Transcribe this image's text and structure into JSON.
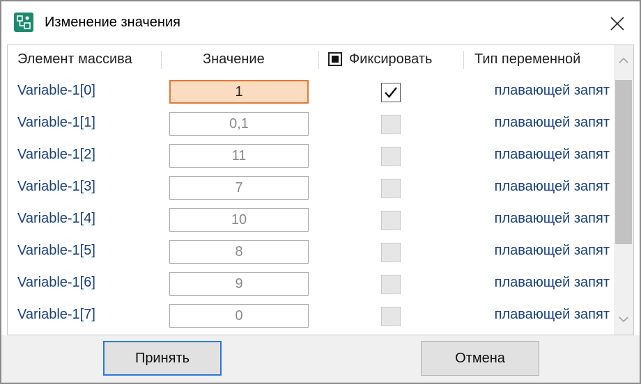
{
  "window": {
    "title": "Изменение значения",
    "icon": "app-icon",
    "close_icon": "close-icon"
  },
  "grid": {
    "headers": {
      "element": "Элемент массива",
      "value": "Значение",
      "fix": "Фиксировать",
      "type": "Тип переменной"
    },
    "rows": [
      {
        "name": "Variable-1[0]",
        "value": "1",
        "fixed": true,
        "type": "плавающей запят"
      },
      {
        "name": "Variable-1[1]",
        "value": "0,1",
        "fixed": false,
        "type": "плавающей запят"
      },
      {
        "name": "Variable-1[2]",
        "value": "11",
        "fixed": false,
        "type": "плавающей запят"
      },
      {
        "name": "Variable-1[3]",
        "value": "7",
        "fixed": false,
        "type": "плавающей запят"
      },
      {
        "name": "Variable-1[4]",
        "value": "10",
        "fixed": false,
        "type": "плавающей запят"
      },
      {
        "name": "Variable-1[5]",
        "value": "8",
        "fixed": false,
        "type": "плавающей запят"
      },
      {
        "name": "Variable-1[6]",
        "value": "9",
        "fixed": false,
        "type": "плавающей запят"
      },
      {
        "name": "Variable-1[7]",
        "value": "0",
        "fixed": false,
        "type": "плавающей запят"
      }
    ]
  },
  "footer": {
    "accept_label": "Принять",
    "cancel_label": "Отмена"
  },
  "colors": {
    "accent_border": "#2b78d4",
    "active_cell_bg": "#fcdcc0",
    "active_cell_border": "#e07a3a",
    "name_text": "#1a3f7a"
  }
}
